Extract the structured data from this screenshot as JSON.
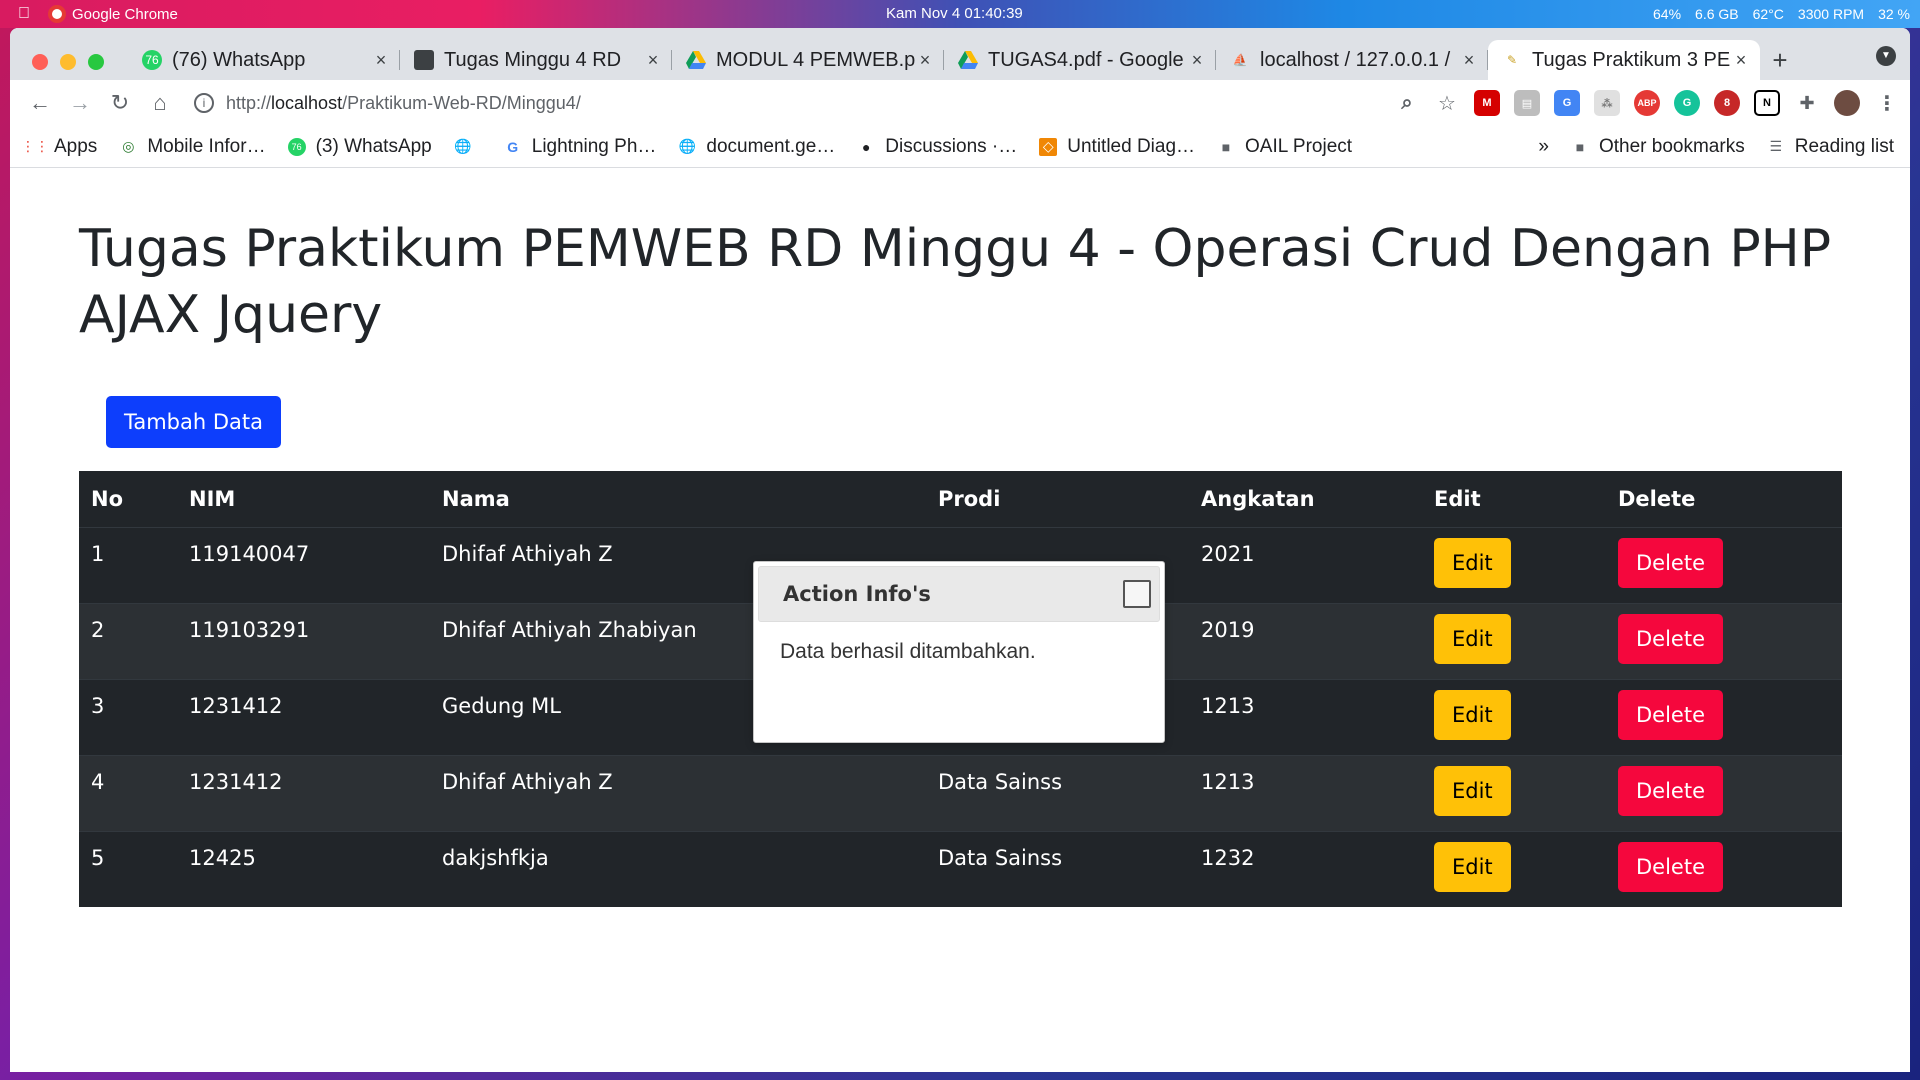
{
  "menubar": {
    "app_name": "Google Chrome",
    "clock": "Kam Nov 4  01:40:39",
    "status": [
      "64%",
      "6.6 GB",
      "62°C",
      "3300 RPM",
      "32 %"
    ]
  },
  "tabs": [
    {
      "title": "(76) WhatsApp",
      "icon": "whatsapp-icon"
    },
    {
      "title": "Tugas Minggu 4 RD",
      "icon": "classroom-icon"
    },
    {
      "title": "MODUL 4 PEMWEB.p",
      "icon": "drive-icon"
    },
    {
      "title": "TUGAS4.pdf - Google",
      "icon": "drive-icon"
    },
    {
      "title": "localhost / 127.0.0.1 /",
      "icon": "phpmyadmin-icon"
    },
    {
      "title": "Tugas Praktikum 3 PE",
      "icon": "page-icon"
    }
  ],
  "toolbar": {
    "url_prefix": "http://",
    "url_host": "localhost",
    "url_path": "/Praktikum-Web-RD/Minggu4/"
  },
  "bookmarks": {
    "items": [
      "Apps",
      "Mobile Infor…",
      "(3) WhatsApp",
      "",
      "Lightning Ph…",
      "document.ge…",
      "Discussions ·…",
      "Untitled Diag…",
      "OAIL Project"
    ],
    "more": "»",
    "other": "Other bookmarks",
    "reading_list": "Reading list"
  },
  "page": {
    "title": "Tugas Praktikum PEMWEB RD Minggu 4 - Operasi Crud Dengan PHP AJAX Jquery",
    "add_button": "Tambah Data"
  },
  "table": {
    "headers": [
      "No",
      "NIM",
      "Nama",
      "Prodi",
      "Angkatan",
      "Edit",
      "Delete"
    ],
    "rows": [
      {
        "no": "1",
        "nim": "119140047",
        "nama": "Dhifaf Athiyah Z",
        "prodi": "",
        "angkatan": "2021",
        "edit": "Edit",
        "delete": "Delete"
      },
      {
        "no": "2",
        "nim": "119103291",
        "nama": "Dhifaf Athiyah Zhabiyan",
        "prodi": "",
        "angkatan": "2019",
        "edit": "Edit",
        "delete": "Delete"
      },
      {
        "no": "3",
        "nim": "1231412",
        "nama": "Gedung ML",
        "prodi": "",
        "angkatan": "1213",
        "edit": "Edit",
        "delete": "Delete"
      },
      {
        "no": "4",
        "nim": "1231412",
        "nama": "Dhifaf Athiyah Z",
        "prodi": "Data Sainss",
        "angkatan": "1213",
        "edit": "Edit",
        "delete": "Delete"
      },
      {
        "no": "5",
        "nim": "12425",
        "nama": "dakjshfkja",
        "prodi": "Data Sainss",
        "angkatan": "1232",
        "edit": "Edit",
        "delete": "Delete"
      }
    ]
  },
  "dialog": {
    "title": "Action Info's",
    "message": "Data berhasil ditambahkan."
  },
  "colors": {
    "primary": "#0d3efc",
    "warning": "#ffc107",
    "danger": "#f5073d",
    "table_dark": "#212529"
  }
}
